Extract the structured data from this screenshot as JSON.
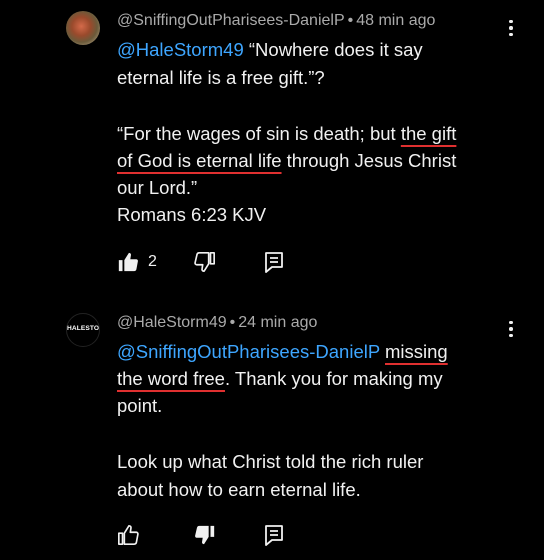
{
  "comments": [
    {
      "author": "@SniffingOutPharisees-DanielP",
      "separator": "•",
      "time": "48 min ago",
      "lines": {
        "l1_mention": "@HaleStorm49",
        "l1_text": " “Nowhere does it say",
        "l2": "eternal life is a free gift.”?",
        "l3_pre": "“For the wages of sin is death; but ",
        "l3_ul": "the gift",
        "l4_ul": "of God is eternal life",
        "l4_post": " through Jesus Christ",
        "l5": "our Lord.”",
        "l6": "Romans 6:23 KJV"
      },
      "like_count": "2",
      "liked": true,
      "icons": [
        "thumbs-up-icon",
        "thumbs-down-icon",
        "reply-icon",
        "more-vert-icon"
      ]
    },
    {
      "author": "@HaleStorm49",
      "avatar_text": "HALESTORM",
      "separator": "•",
      "time": "24 min ago",
      "lines": {
        "l1_mention": "@SniffingOutPharisees-DanielP",
        "l1_ul": "missing",
        "l2_ul": "the word free",
        "l2_post": ". Thank you for making my",
        "l3": "point.",
        "l4": "Look up what Christ told the rich ruler",
        "l5": "about how to earn eternal life."
      },
      "disliked": true,
      "icons": [
        "thumbs-up-icon",
        "thumbs-down-icon",
        "reply-icon",
        "more-vert-icon"
      ]
    }
  ],
  "colors": {
    "background": "#000000",
    "mention": "#3ea6ff",
    "underline": "#e03030",
    "meta": "#aaaaaa"
  }
}
